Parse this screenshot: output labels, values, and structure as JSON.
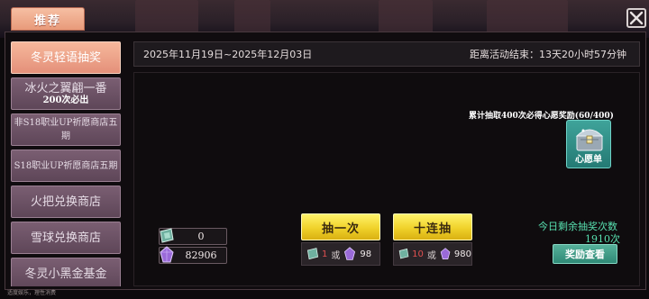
{
  "header": {
    "tab_title": "推荐"
  },
  "sidebar": {
    "items": [
      {
        "label": "冬灵轻语抽奖",
        "sub": ""
      },
      {
        "label": "冰火之翼翩一番",
        "sub": "200次必出"
      },
      {
        "label": "非S18职业UP祈愿商店五期",
        "sub": ""
      },
      {
        "label": "S18职业UP祈愿商店五期",
        "sub": ""
      },
      {
        "label": "火把兑换商店",
        "sub": ""
      },
      {
        "label": "雪球兑换商店",
        "sub": ""
      },
      {
        "label": "冬灵小黑金基金",
        "sub": ""
      }
    ]
  },
  "event": {
    "date_range": "2025年11月19日~2025年12月03日",
    "countdown": "距离活动结束：13天20小时57分钟"
  },
  "wish": {
    "progress_text": "累计抽取400次必得心愿奖励(60/400)",
    "button_label": "心愿单"
  },
  "currency": {
    "ticket_count": "0",
    "crystal_count": "82906"
  },
  "draw": {
    "single_label": "抽一次",
    "ten_label": "十连抽",
    "single_ticket_cost": "1",
    "single_crystal_cost": "98",
    "ten_ticket_cost": "10",
    "ten_crystal_cost": "980",
    "or_text": "或"
  },
  "remaining": {
    "label": "今日剩余抽奖次数",
    "count": "1910次",
    "reward_button": "奖励查看"
  },
  "footer": {
    "note": "适度娱乐，理性消费"
  },
  "icons": {
    "close": "close-icon",
    "ticket": "ticket-icon",
    "crystal": "crystal-icon",
    "chest": "treasure-chest-icon"
  },
  "colors": {
    "active_tab": "#e89a7a",
    "draw_button": "#f0d22a",
    "accent_teal": "#58e0b0",
    "cost_red": "#e05050"
  }
}
